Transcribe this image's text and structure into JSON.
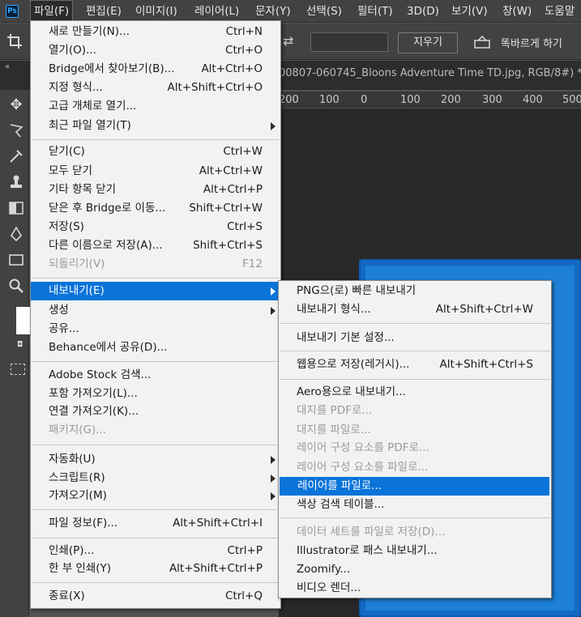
{
  "app": {
    "logo": "Ps"
  },
  "menubar": {
    "items": [
      "파일(F)",
      "편집(E)",
      "이미지(I)",
      "레이어(L)",
      "문자(Y)",
      "선택(S)",
      "필터(T)",
      "3D(D)",
      "보기(V)",
      "창(W)",
      "도움말"
    ]
  },
  "options": {
    "clear_button": "지우기",
    "straighten_label": "똑바르게 하기"
  },
  "document": {
    "tab_title": "00807-060745_Bloons Adventure Time TD.jpg, RGB/8#) *"
  },
  "ruler": {
    "ticks": [
      "200",
      "100",
      "0",
      "100",
      "200",
      "300",
      "400",
      "500"
    ]
  },
  "file_menu": {
    "items": [
      {
        "label": "새로 만들기(N)...",
        "shortcut": "Ctrl+N"
      },
      {
        "label": "열기(O)...",
        "shortcut": "Ctrl+O"
      },
      {
        "label": "Bridge에서 찾아보기(B)...",
        "shortcut": "Alt+Ctrl+O"
      },
      {
        "label": "지정 형식...",
        "shortcut": "Alt+Shift+Ctrl+O"
      },
      {
        "label": "고급 개체로 열기...",
        "shortcut": ""
      },
      {
        "label": "최근 파일 열기(T)",
        "shortcut": ""
      },
      {
        "label": "닫기(C)",
        "shortcut": "Ctrl+W"
      },
      {
        "label": "모두 닫기",
        "shortcut": "Alt+Ctrl+W"
      },
      {
        "label": "기타 항목 닫기",
        "shortcut": "Alt+Ctrl+P"
      },
      {
        "label": "닫은 후 Bridge로 이동...",
        "shortcut": "Shift+Ctrl+W"
      },
      {
        "label": "저장(S)",
        "shortcut": "Ctrl+S"
      },
      {
        "label": "다른 이름으로 저장(A)...",
        "shortcut": "Shift+Ctrl+S"
      },
      {
        "label": "되돌리기(V)",
        "shortcut": "F12"
      },
      {
        "label": "내보내기(E)",
        "shortcut": ""
      },
      {
        "label": "생성",
        "shortcut": ""
      },
      {
        "label": "공유...",
        "shortcut": ""
      },
      {
        "label": "Behance에서 공유(D)...",
        "shortcut": ""
      },
      {
        "label": "Adobe Stock 검색...",
        "shortcut": ""
      },
      {
        "label": "포함 가져오기(L)...",
        "shortcut": ""
      },
      {
        "label": "연결 가져오기(K)...",
        "shortcut": ""
      },
      {
        "label": "패키지(G)...",
        "shortcut": ""
      },
      {
        "label": "자동화(U)",
        "shortcut": ""
      },
      {
        "label": "스크립트(R)",
        "shortcut": ""
      },
      {
        "label": "가져오기(M)",
        "shortcut": ""
      },
      {
        "label": "파일 정보(F)...",
        "shortcut": "Alt+Shift+Ctrl+I"
      },
      {
        "label": "인쇄(P)...",
        "shortcut": "Ctrl+P"
      },
      {
        "label": "한 부 인쇄(Y)",
        "shortcut": "Alt+Shift+Ctrl+P"
      },
      {
        "label": "종료(X)",
        "shortcut": "Ctrl+Q"
      }
    ]
  },
  "export_menu": {
    "items": [
      {
        "label": "PNG으(로) 빠른 내보내기",
        "shortcut": ""
      },
      {
        "label": "내보내기 형식...",
        "shortcut": "Alt+Shift+Ctrl+W"
      },
      {
        "label": "내보내기 기본 설정...",
        "shortcut": ""
      },
      {
        "label": "웹용으로 저장(레거시)...",
        "shortcut": "Alt+Shift+Ctrl+S"
      },
      {
        "label": "Aero용으로 내보내기...",
        "shortcut": ""
      },
      {
        "label": "대지를 PDF로...",
        "shortcut": ""
      },
      {
        "label": "대지를 파일로...",
        "shortcut": ""
      },
      {
        "label": "레이어 구성 요소를 PDF로...",
        "shortcut": ""
      },
      {
        "label": "레이어 구성 요소를 파일로...",
        "shortcut": ""
      },
      {
        "label": "레이어를 파일로...",
        "shortcut": ""
      },
      {
        "label": "색상 검색 테이블...",
        "shortcut": ""
      },
      {
        "label": "데이터 세트를 파일로 저장(D)...",
        "shortcut": ""
      },
      {
        "label": "Illustrator로 패스 내보내기...",
        "shortcut": ""
      },
      {
        "label": "Zoomify...",
        "shortcut": ""
      },
      {
        "label": "비디오 렌더...",
        "shortcut": ""
      }
    ]
  }
}
